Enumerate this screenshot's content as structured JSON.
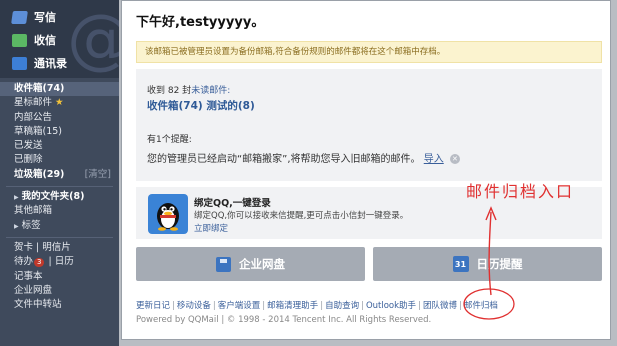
{
  "sidebar": {
    "compose": "写信",
    "receive": "收信",
    "contacts": "通讯录",
    "folders": [
      {
        "label": "收件箱(74)",
        "style": "active"
      },
      {
        "label": "星标邮件",
        "style": "star"
      },
      {
        "label": "内部公告",
        "style": ""
      },
      {
        "label": "草稿箱(15)",
        "style": ""
      },
      {
        "label": "已发送",
        "style": ""
      },
      {
        "label": "已删除",
        "style": ""
      },
      {
        "label": "垃圾箱(29)",
        "style": "bold",
        "extra": "[清空]"
      }
    ],
    "my_folders": "我的文件夹(8)",
    "other_mailbox": "其他邮箱",
    "tags": "标签",
    "card": "贺卡",
    "postcard": "明信片",
    "todo": "待办",
    "todo_badge": "3",
    "calendar": "日历",
    "notebook": "记事本",
    "enterprise_disk": "企业网盘",
    "file_transfer": "文件中转站"
  },
  "main": {
    "greeting_prefix": "下午好,",
    "username": "testyyyyy",
    "greeting_suffix": "。",
    "notice": "该邮箱已被管理员设置为备份邮箱,符合备份规则的邮件都将在这个邮箱中存档。",
    "received_prefix": "收到 82 封",
    "received_link": "未读邮件:",
    "folder_line": "收件箱(74) 测试的(8)",
    "tips_title": "有1个提醒:",
    "tips_text": "您的管理员已经启动“邮箱搬家”,将帮助您导入旧邮箱的邮件。",
    "tips_link": "导入",
    "qq_title": "绑定QQ,一键登录",
    "qq_desc": "绑定QQ,你可以接收来信提醒,更可点击小信封一键登录。",
    "qq_link": "立即绑定",
    "btn_disk": "企业网盘",
    "btn_calendar": "日历提醒",
    "calendar_icon_text": "31"
  },
  "footer": {
    "links": [
      "更新日记",
      "移动设备",
      "客户端设置",
      "邮箱清理助手",
      "自助查询",
      "Outlook助手",
      "团队微博",
      "邮件归档"
    ],
    "copyright": "Powered by QQMail | © 1998 - 2014 Tencent Inc. All Rights Reserved."
  },
  "annotation": {
    "text": "邮件归档入口",
    "color": "#e03030"
  }
}
